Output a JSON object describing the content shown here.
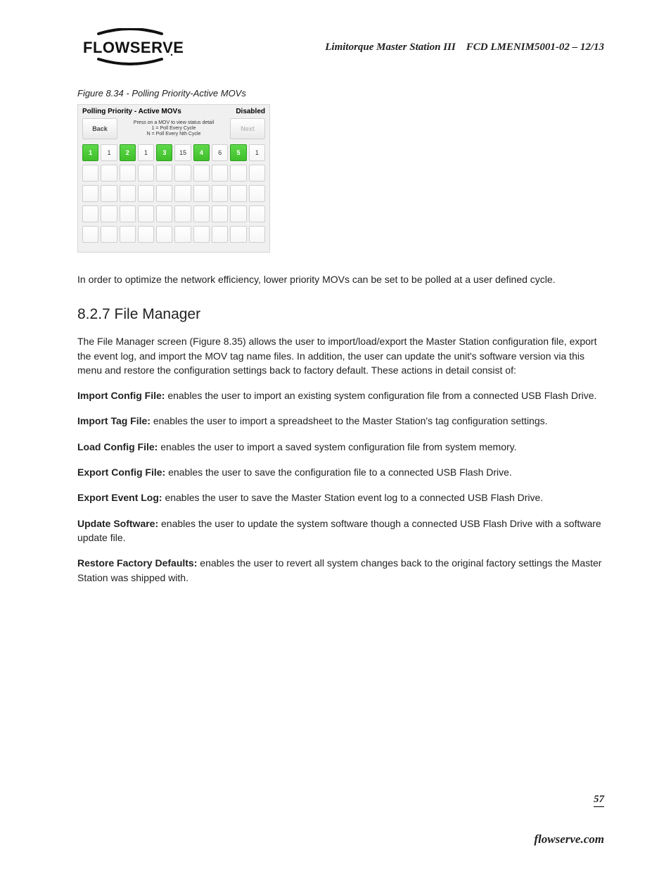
{
  "header": {
    "doc_title": "Limitorque Master Station III    FCD LMENIM5001-02 – 12/13",
    "logo_text": "FLOWSERVE"
  },
  "figure": {
    "caption": "Figure 8.34 - Polling Priority-Active MOVs",
    "panel_title": "Polling Priority - Active MOVs",
    "status": "Disabled",
    "back": "Back",
    "next": "Next",
    "instr1": "Press on a MOV to view status detail",
    "instr2": "1 = Poll Every Cycle",
    "instr3": "N = Poll Every Nth Cycle",
    "row0": [
      {
        "id": "1",
        "green": true
      },
      {
        "val": "1"
      },
      {
        "id": "2",
        "green": true
      },
      {
        "val": "1"
      },
      {
        "id": "3",
        "green": true
      },
      {
        "val": "15"
      },
      {
        "id": "4",
        "green": true
      },
      {
        "val": "6"
      },
      {
        "id": "5",
        "green": true
      },
      {
        "val": "1"
      }
    ]
  },
  "body": {
    "intro": "In order to optimize the network efficiency, lower priority MOVs can be set to be polled at a user defined cycle.",
    "section_title": "8.2.7 File Manager",
    "p1": "The File Manager screen (Figure 8.35) allows the user to import/load/export the Master Station configuration file, export the event log, and import the MOV tag name files. In addition, the user can update the unit's software version via this menu and restore the configuration settings back to factory default. These actions in detail consist of:",
    "items": [
      {
        "b": "Import Config File:",
        "t": " enables the user to import an existing system configuration file from a connected USB Flash Drive."
      },
      {
        "b": "Import Tag File:",
        "t": " enables the user to import a spreadsheet to the Master Station's tag configuration settings."
      },
      {
        "b": "Load Config File:",
        "t": " enables the user to import a saved system configuration file from system memory."
      },
      {
        "b": "Export Config File:",
        "t": " enables the user to save the configuration file to a connected USB Flash Drive."
      },
      {
        "b": "Export Event Log:",
        "t": " enables the user to save the Master Station event log to a connected USB Flash Drive."
      },
      {
        "b": "Update Software:",
        "t": " enables the user to update the system software though a connected USB Flash Drive with a software update file."
      },
      {
        "b": "Restore Factory Defaults:",
        "t": " enables the user to revert all system changes back to the original factory settings the Master Station was shipped with."
      }
    ]
  },
  "footer": {
    "page": "57",
    "url": "flowserve.com"
  }
}
